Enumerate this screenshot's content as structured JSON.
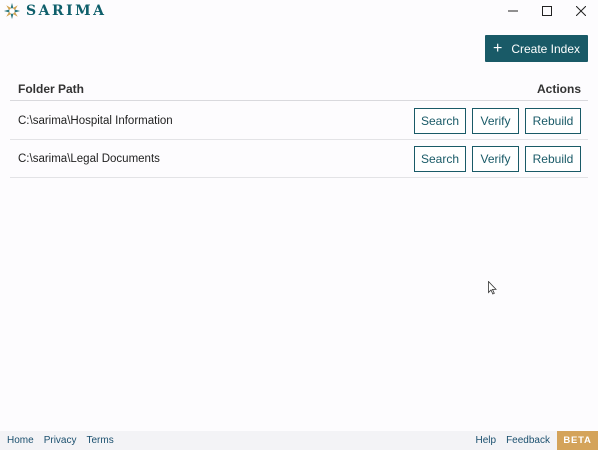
{
  "app": {
    "name": "SARIMA",
    "brand_color": "#195a67",
    "logo_icon": "sunburst-icon"
  },
  "window_controls": {
    "minimize_icon": "minimize-icon",
    "maximize_icon": "maximize-icon",
    "close_icon": "close-icon"
  },
  "toolbar": {
    "create_index_label": "Create Index",
    "create_index_icon": "plus-icon"
  },
  "table": {
    "headers": {
      "path": "Folder Path",
      "actions": "Actions"
    },
    "rows": [
      {
        "path": "C:\\sarima\\Hospital Information",
        "search": "Search",
        "verify": "Verify",
        "rebuild": "Rebuild"
      },
      {
        "path": "C:\\sarima\\Legal Documents",
        "search": "Search",
        "verify": "Verify",
        "rebuild": "Rebuild"
      }
    ]
  },
  "footer": {
    "links_left": [
      "Home",
      "Privacy",
      "Terms"
    ],
    "links_right": [
      "Help",
      "Feedback"
    ],
    "badge": "BETA",
    "badge_color": "#d4a35a"
  }
}
